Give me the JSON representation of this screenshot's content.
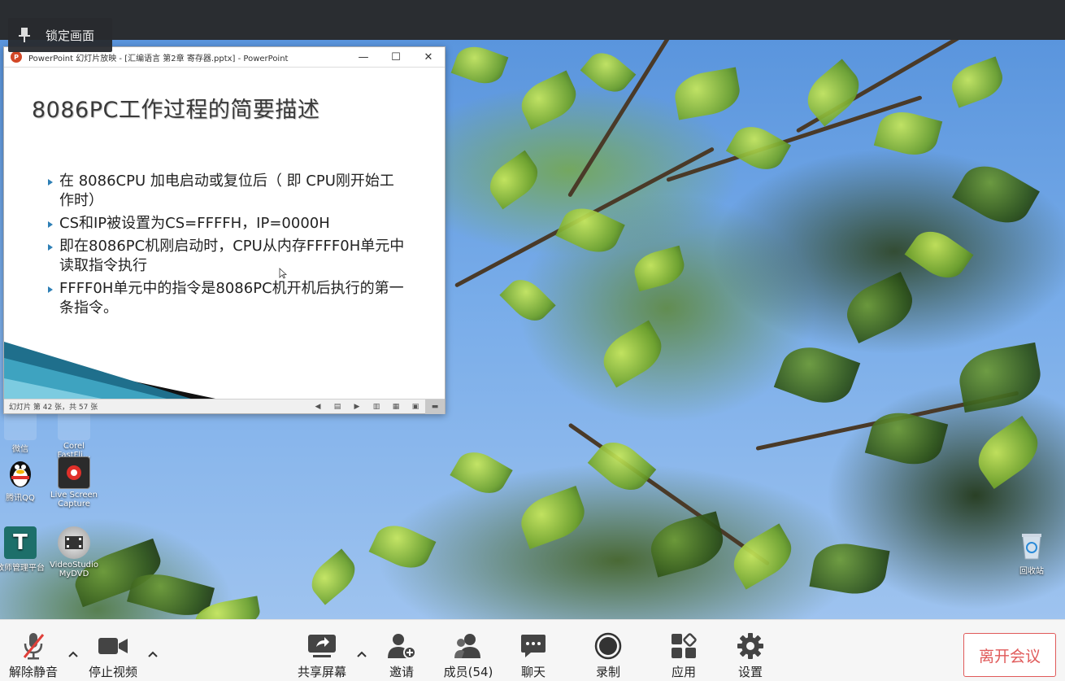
{
  "meeting": {
    "lock_view_label": "锁定画面"
  },
  "ppt_window": {
    "title": "PowerPoint 幻灯片放映 - [汇编语言 第2章 寄存器.pptx] - PowerPoint",
    "minimize": "—",
    "maximize": "☐",
    "close": "✕",
    "logo_letter": "P",
    "status_text": "幻灯片 第 42 张，共 57 张"
  },
  "slide": {
    "title": "8086PC工作过程的简要描述",
    "bullets": [
      "在 8086CPU 加电启动或复位后（ 即 CPU刚开始工作时）",
      "CS和IP被设置为CS=FFFFH，IP=0000H",
      "即在8086PC机刚启动时，CPU从内存FFFF0H单元中读取指令执行",
      "FFFF0H单元中的指令是8086PC机开机后执行的第一条指令。"
    ]
  },
  "desktop": {
    "icons": [
      {
        "label": "微信",
        "icon": "wechat-icon"
      },
      {
        "label": "Corel FastFli...",
        "icon": "corel-icon"
      },
      {
        "label": "腾讯QQ",
        "icon": "qq-penguin-icon"
      },
      {
        "label": "Live Screen Capture",
        "icon": "screen-capture-icon"
      },
      {
        "label": "教师管理平台",
        "icon": "teacher-platform-icon"
      },
      {
        "label": "VideoStudio MyDVD",
        "icon": "videostudio-icon"
      },
      {
        "label": "回收站",
        "icon": "recycle-bin-icon"
      }
    ]
  },
  "toolbar": {
    "unmute": "解除静音",
    "stop_video": "停止视频",
    "share_screen": "共享屏幕",
    "invite": "邀请",
    "members": "成员(54)",
    "chat": "聊天",
    "record": "录制",
    "apps": "应用",
    "settings": "设置",
    "leave": "离开会议"
  },
  "colors": {
    "leave_red": "#e05a5a",
    "mic_muted_red": "#e0403a",
    "bullet_blue": "#2e7fb5",
    "ppt_orange": "#d24726"
  }
}
